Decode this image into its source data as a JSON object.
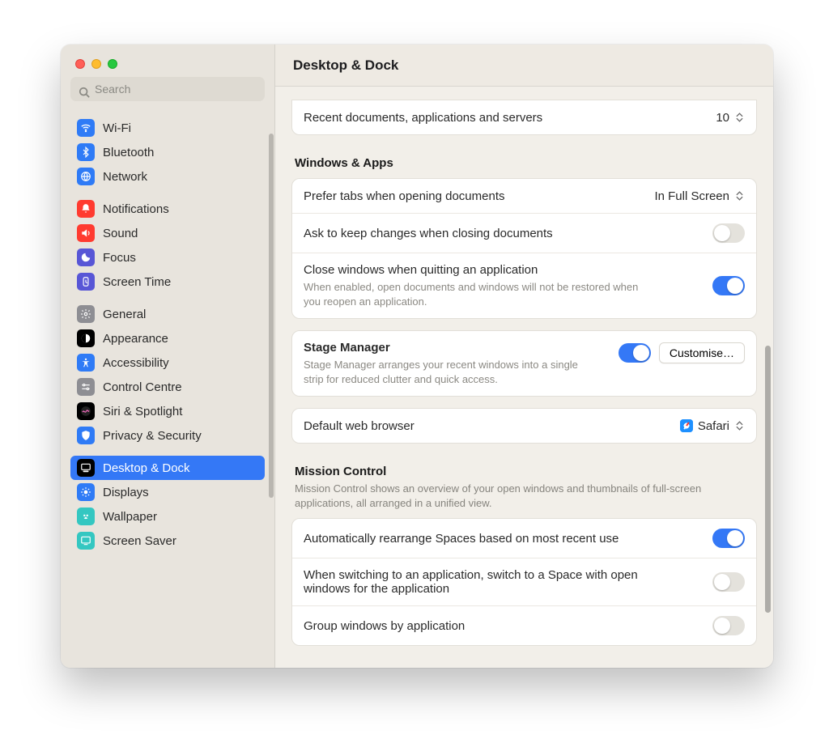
{
  "header": {
    "title": "Desktop & Dock"
  },
  "search": {
    "placeholder": "Search"
  },
  "sidebar": {
    "groups": [
      [
        {
          "label": "Wi-Fi",
          "icon": "wifi",
          "bg": "#2f7bf6"
        },
        {
          "label": "Bluetooth",
          "icon": "bluetooth",
          "bg": "#2f7bf6"
        },
        {
          "label": "Network",
          "icon": "network",
          "bg": "#2f7bf6"
        }
      ],
      [
        {
          "label": "Notifications",
          "icon": "notifications",
          "bg": "#ff3b30"
        },
        {
          "label": "Sound",
          "icon": "sound",
          "bg": "#ff3b30"
        },
        {
          "label": "Focus",
          "icon": "focus",
          "bg": "#5856d6"
        },
        {
          "label": "Screen Time",
          "icon": "screentime",
          "bg": "#5856d6"
        }
      ],
      [
        {
          "label": "General",
          "icon": "general",
          "bg": "#8e8e93"
        },
        {
          "label": "Appearance",
          "icon": "appearance",
          "bg": "#000000"
        },
        {
          "label": "Accessibility",
          "icon": "accessibility",
          "bg": "#2f7bf6"
        },
        {
          "label": "Control Centre",
          "icon": "control",
          "bg": "#8e8e93"
        },
        {
          "label": "Siri & Spotlight",
          "icon": "siri",
          "bg": "#000000"
        },
        {
          "label": "Privacy & Security",
          "icon": "privacy",
          "bg": "#2f7bf6"
        }
      ],
      [
        {
          "label": "Desktop & Dock",
          "icon": "desktopdock",
          "bg": "#000000",
          "selected": true
        },
        {
          "label": "Displays",
          "icon": "displays",
          "bg": "#2f7bf6"
        },
        {
          "label": "Wallpaper",
          "icon": "wallpaper",
          "bg": "#34c7c1"
        },
        {
          "label": "Screen Saver",
          "icon": "screensaver",
          "bg": "#34c7c1"
        }
      ]
    ]
  },
  "recentRow": {
    "label": "Recent documents, applications and servers",
    "value": "10"
  },
  "section1": {
    "title": "Windows & Apps"
  },
  "preferTabs": {
    "label": "Prefer tabs when opening documents",
    "value": "In Full Screen"
  },
  "askKeep": {
    "label": "Ask to keep changes when closing documents",
    "on": false
  },
  "closeWin": {
    "label": "Close windows when quitting an application",
    "desc": "When enabled, open documents and windows will not be restored when you reopen an application.",
    "on": true
  },
  "stage": {
    "label": "Stage Manager",
    "desc": "Stage Manager arranges your recent windows into a single strip for reduced clutter and quick access.",
    "on": true,
    "customise": "Customise…"
  },
  "browser": {
    "label": "Default web browser",
    "value": "Safari"
  },
  "mission": {
    "title": "Mission Control",
    "desc": "Mission Control shows an overview of your open windows and thumbnails of full-screen applications, all arranged in a unified view."
  },
  "autoSpaces": {
    "label": "Automatically rearrange Spaces based on most recent use",
    "on": true
  },
  "switchApp": {
    "label": "When switching to an application, switch to a Space with open windows for the application",
    "on": false
  },
  "groupWin": {
    "label": "Group windows by application",
    "on": false
  }
}
